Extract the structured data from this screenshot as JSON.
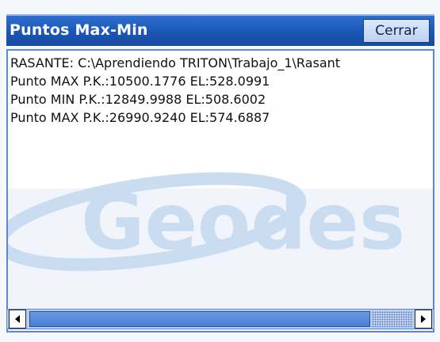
{
  "window": {
    "title": "Puntos Max-Min",
    "close_label": "Cerrar"
  },
  "content": {
    "lines": [
      "RASANTE: C:\\Aprendiendo TRITON\\Trabajo_1\\Rasant",
      "Punto MAX P.K.:10500.1776 EL:528.0991",
      "Punto MIN P.K.:12849.9988 EL:508.6002",
      "Punto MAX P.K.:26990.9240 EL:574.6887"
    ],
    "watermark_text": "Geodes",
    "watermark_color": "#c9dcf0"
  },
  "scrollbar": {
    "left_icon": "arrow-left-icon",
    "right_icon": "arrow-right-icon"
  }
}
